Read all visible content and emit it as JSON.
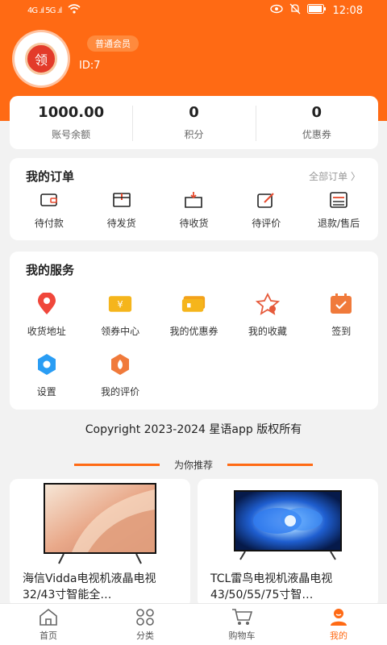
{
  "status_bar": {
    "signal": "4G .ıl 5G .ıl",
    "time": "12:08"
  },
  "profile": {
    "avatar_text": "领",
    "member_level": "普通会员",
    "user_id": "ID:7"
  },
  "stats": [
    {
      "value": "1000.00",
      "label": "账号余额"
    },
    {
      "value": "0",
      "label": "积分"
    },
    {
      "value": "0",
      "label": "优惠券"
    }
  ],
  "orders": {
    "title": "我的订单",
    "all_link": "全部订单 〉",
    "items": [
      {
        "label": "待付款",
        "icon": "wallet-icon"
      },
      {
        "label": "待发货",
        "icon": "package-icon"
      },
      {
        "label": "待收货",
        "icon": "box-receive-icon"
      },
      {
        "label": "待评价",
        "icon": "edit-icon"
      },
      {
        "label": "退款/售后",
        "icon": "list-icon"
      }
    ]
  },
  "services": {
    "title": "我的服务",
    "items": [
      {
        "label": "收货地址",
        "icon": "location-pin-icon",
        "color": "#f0473b"
      },
      {
        "label": "领券中心",
        "icon": "ticket-icon",
        "color": "#f5b51c"
      },
      {
        "label": "我的优惠券",
        "icon": "coupon-icon",
        "color": "#f5b51c"
      },
      {
        "label": "我的收藏",
        "icon": "star-icon",
        "color": "#e65a3b"
      },
      {
        "label": "签到",
        "icon": "calendar-icon",
        "color": "#f07a3b"
      },
      {
        "label": "设置",
        "icon": "settings-icon",
        "color": "#2a9df4"
      },
      {
        "label": "我的评价",
        "icon": "review-icon",
        "color": "#f07a3b"
      }
    ]
  },
  "copyright": "Copyright 2023-2024 星语app 版权所有",
  "recommend_title": "为你推荐",
  "products": [
    {
      "name": "海信Vidda电视机液晶电视32/43寸智能全…"
    },
    {
      "name": "TCL雷鸟电视机液晶电视43/50/55/75寸智…"
    }
  ],
  "tabbar": [
    {
      "label": "首页",
      "icon": "home-icon"
    },
    {
      "label": "分类",
      "icon": "category-icon"
    },
    {
      "label": "购物车",
      "icon": "cart-icon"
    },
    {
      "label": "我的",
      "icon": "user-icon",
      "active": true
    }
  ],
  "colors": {
    "brand": "#ff6a14",
    "background": "#f2f2f2"
  }
}
